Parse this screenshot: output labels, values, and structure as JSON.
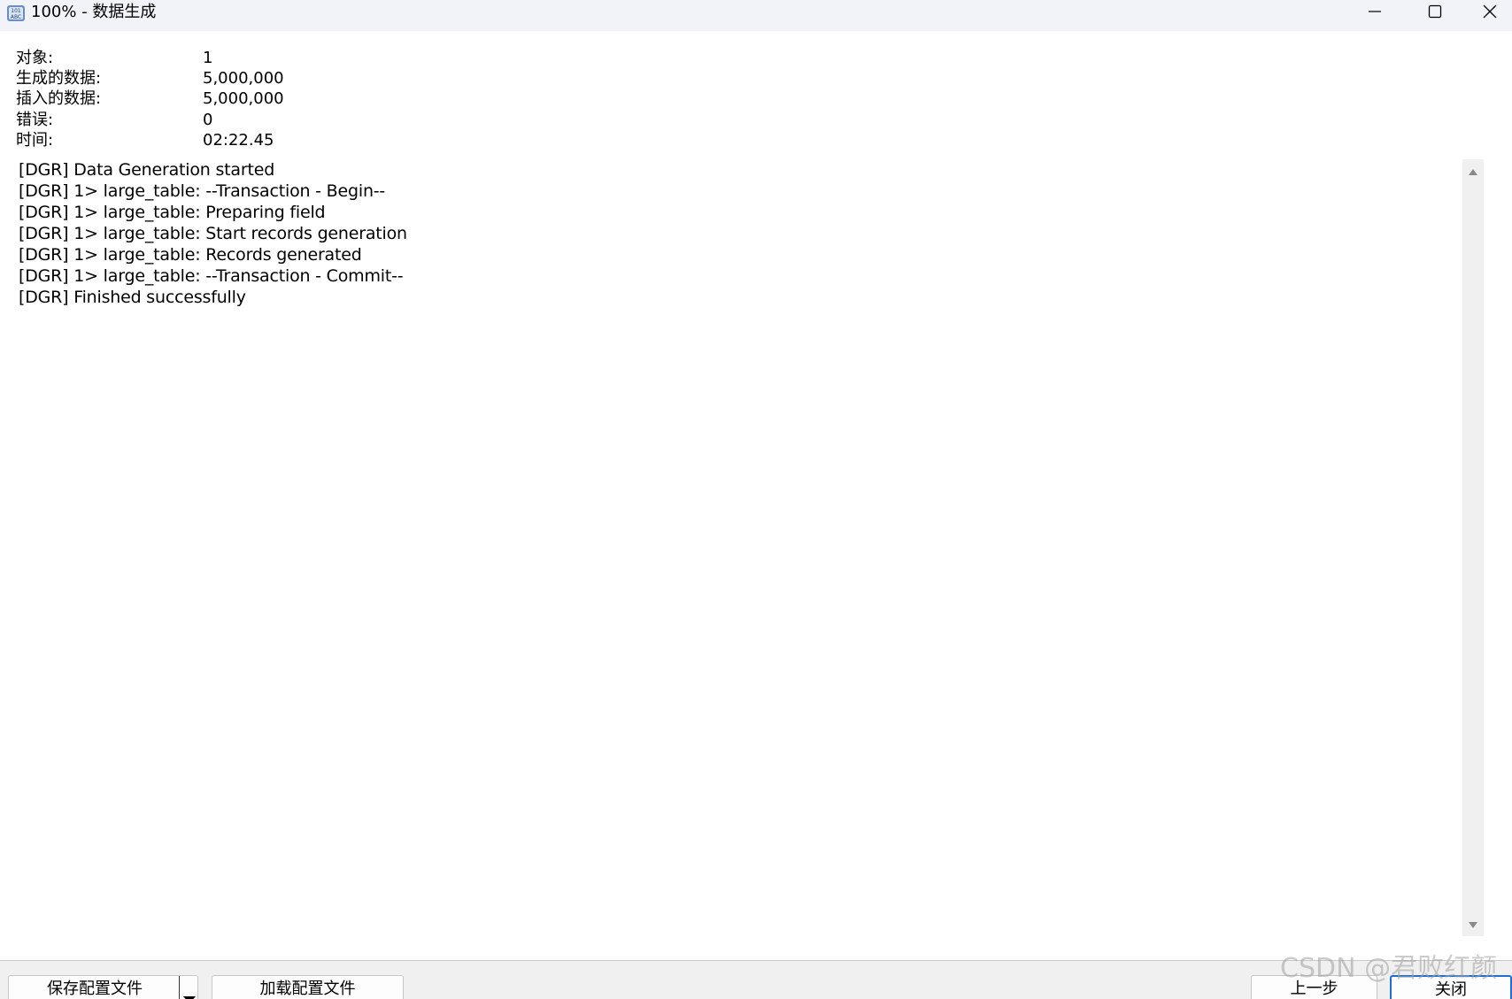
{
  "window": {
    "title": "100% - 数据生成"
  },
  "stats": [
    {
      "label": "对象:",
      "value": "1"
    },
    {
      "label": "生成的数据:",
      "value": "5,000,000"
    },
    {
      "label": "插入的数据:",
      "value": "5,000,000"
    },
    {
      "label": "错误:",
      "value": "0"
    },
    {
      "label": "时间:",
      "value": "02:22.45"
    }
  ],
  "log": [
    "[DGR] Data Generation started",
    "[DGR] 1> large_table: --Transaction - Begin--",
    "[DGR] 1> large_table: Preparing field",
    "[DGR] 1> large_table: Start records generation",
    "[DGR] 1> large_table: Records generated",
    "[DGR] 1> large_table: --Transaction - Commit--",
    "[DGR] Finished successfully"
  ],
  "buttons": {
    "save_profile": "保存配置文件",
    "load_profile": "加载配置文件",
    "back": "上一步",
    "close": "关闭"
  },
  "watermark": "CSDN @君败红颜",
  "icons": {
    "app": "data-generation-icon",
    "minimize": "minimize-icon",
    "maximize": "maximize-icon",
    "close": "close-icon",
    "scroll_up": "scroll-up-arrow-icon",
    "scroll_down": "scroll-down-arrow-icon",
    "dropdown": "dropdown-arrow-icon"
  },
  "colors": {
    "titlebar_bg": "#f1f3f8",
    "focus_border": "#1f6fd1"
  }
}
